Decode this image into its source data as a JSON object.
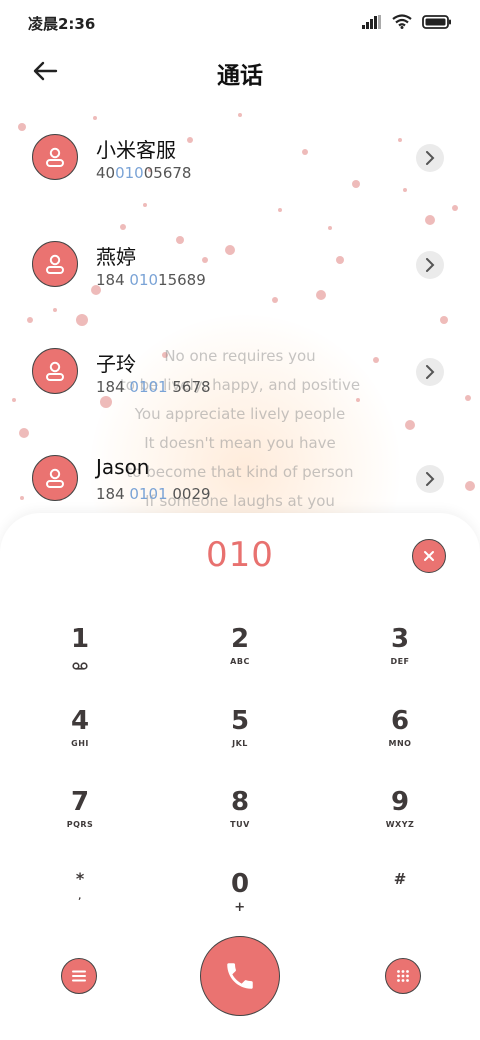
{
  "status": {
    "time": "凌晨2:36"
  },
  "header": {
    "title": "通话"
  },
  "contacts": [
    {
      "name": "小米客服",
      "number_pre": "40",
      "number_hl": "010",
      "number_post": "05678"
    },
    {
      "name": "燕婷",
      "number_pre": "184 ",
      "number_hl": "010",
      "number_post": "15689"
    },
    {
      "name": "子玲",
      "number_pre": "184 ",
      "number_hl": "0101",
      "number_post": " 5678"
    },
    {
      "name": "Jason",
      "number_pre": "184 ",
      "number_hl": "0101",
      "number_post": " 0029"
    }
  ],
  "quote": [
    "No one requires you",
    "to be lively, happy, and positive",
    "You appreciate lively people",
    "It doesn't mean you have",
    "to become that kind of person",
    "If someone laughs at you"
  ],
  "dialer": {
    "input": "010",
    "keys": [
      {
        "digit": "1",
        "letters": ""
      },
      {
        "digit": "2",
        "letters": "ABC"
      },
      {
        "digit": "3",
        "letters": "DEF"
      },
      {
        "digit": "4",
        "letters": "GHI"
      },
      {
        "digit": "5",
        "letters": "JKL"
      },
      {
        "digit": "6",
        "letters": "MNO"
      },
      {
        "digit": "7",
        "letters": "PQRS"
      },
      {
        "digit": "8",
        "letters": "TUV"
      },
      {
        "digit": "9",
        "letters": "WXYZ"
      },
      {
        "digit": "*",
        "letters": ","
      },
      {
        "digit": "0",
        "letters": "+"
      },
      {
        "digit": "#",
        "letters": ""
      }
    ]
  },
  "colors": {
    "accent": "#ea7371",
    "highlight": "#7aa3d6",
    "key_text": "#3f3a3a"
  },
  "icons": {
    "back": "arrow-left-icon",
    "avatar": "person-icon",
    "chevron": "chevron-right-icon",
    "clear": "close-icon",
    "menu": "menu-icon",
    "call": "phone-icon",
    "keypad": "keypad-icon",
    "voicemail": "voicemail-icon"
  }
}
